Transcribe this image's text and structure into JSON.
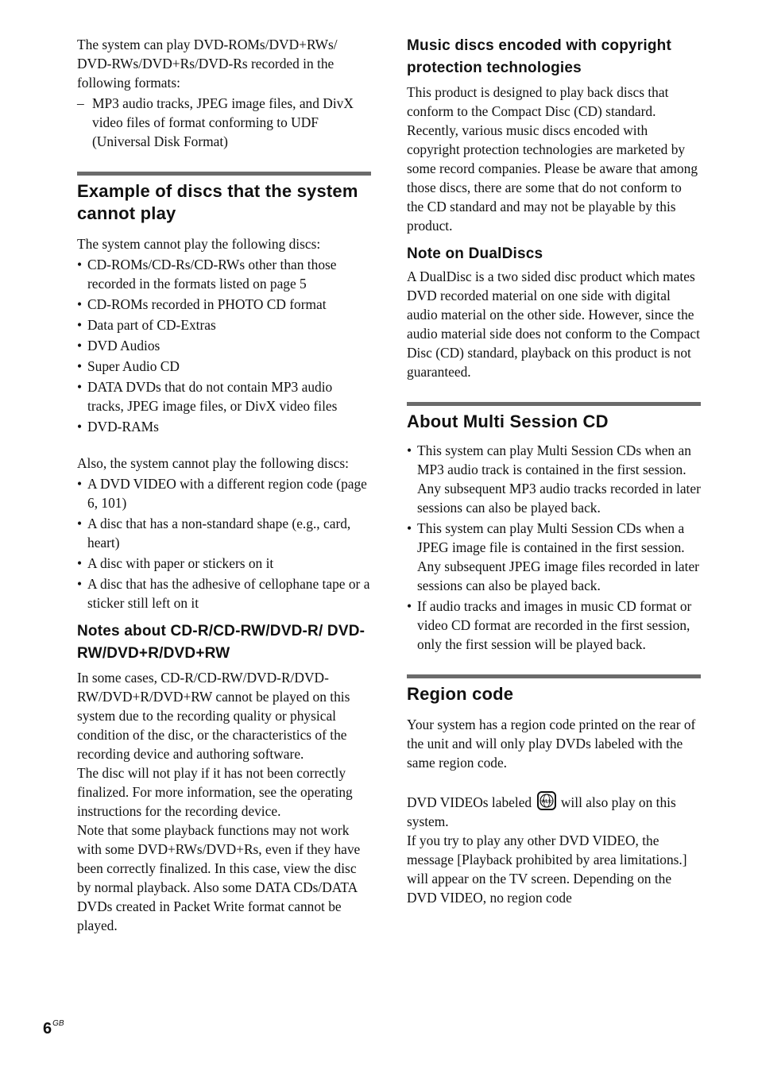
{
  "left": {
    "intro": "The system can play DVD-ROMs/DVD+RWs/ DVD-RWs/DVD+Rs/DVD-Rs recorded in the following formats:",
    "intro_items": [
      "MP3 audio tracks, JPEG image files, and DivX video files of format conforming to UDF (Universal Disk Format)"
    ],
    "cannot_play": {
      "heading": "Example of discs that the system cannot play",
      "lead": "The system cannot play the following discs:",
      "items": [
        "CD-ROMs/CD-Rs/CD-RWs other than those recorded in the formats listed on page 5",
        "CD-ROMs recorded in PHOTO CD format",
        "Data part of CD-Extras",
        "DVD Audios",
        "Super Audio CD",
        "DATA DVDs that do not contain MP3 audio tracks, JPEG image files, or DivX video files",
        "DVD-RAMs"
      ],
      "also_lead": "Also, the system cannot play the following discs:",
      "also_items": [
        "A DVD VIDEO with a different region code (page 6, 101)",
        "A disc that has a non-standard shape (e.g., card, heart)",
        "A disc with paper or stickers on it",
        "A disc that has the adhesive of cellophane tape or a sticker still left on it"
      ]
    },
    "notes_cdr": {
      "heading": "Notes about CD-R/CD-RW/DVD-R/ DVD-RW/DVD+R/DVD+RW",
      "paragraphs": [
        "In some cases, CD-R/CD-RW/DVD-R/DVD-RW/DVD+R/DVD+RW cannot be played on this system due to the recording quality or physical condition of the disc, or the characteristics of the recording device and authoring software.",
        "The disc will not play if it has not been correctly finalized. For more information, see the operating instructions for the recording device.",
        "Note that some playback functions may not work with some DVD+RWs/DVD+Rs, even if they have been correctly finalized. In this case, view the disc by normal playback. Also some DATA CDs/DATA DVDs created in Packet Write format cannot be played."
      ]
    }
  },
  "right": {
    "music_discs": {
      "heading": "Music discs encoded with copyright protection technologies",
      "body": "This product is designed to play back discs that conform to the Compact Disc (CD) standard. Recently, various music discs encoded with copyright protection technologies are marketed by some record companies. Please be aware that among those discs, there are some that do not conform to the CD standard and may not be playable by this product."
    },
    "dualdiscs": {
      "heading": "Note on DualDiscs",
      "body": "A DualDisc is a two sided disc product which mates DVD recorded material on one side with digital audio material on the other side. However, since the audio material side does not conform to the Compact Disc (CD) standard, playback on this product is not guaranteed."
    },
    "multi_session": {
      "heading": "About Multi Session CD",
      "items": [
        "This system can play Multi Session CDs when an MP3 audio track is contained in the first session. Any subsequent MP3 audio tracks recorded in later sessions can also be played back.",
        "This system can play Multi Session CDs when a JPEG image file is contained in the first session. Any subsequent JPEG image files recorded in later sessions can also be played back.",
        "If audio tracks and images in music CD format or video CD format are recorded in the first session, only the first session will be played back."
      ]
    },
    "region_code": {
      "heading": "Region code",
      "body": "Your system has a region code printed on the rear of the unit and will only play DVDs labeled with the same region code.",
      "labeled_before": "DVD VIDEOs labeled",
      "labeled_icon": "all-region-globe-icon",
      "labeled_icon_text": "ALL",
      "labeled_after": "will also play on this system.",
      "tail": "If you try to play any other DVD VIDEO, the message [Playback prohibited by area limitations.] will appear on the TV screen. Depending on the DVD VIDEO, no region code"
    }
  },
  "footer": {
    "page_number": "6",
    "page_suffix": "GB"
  }
}
